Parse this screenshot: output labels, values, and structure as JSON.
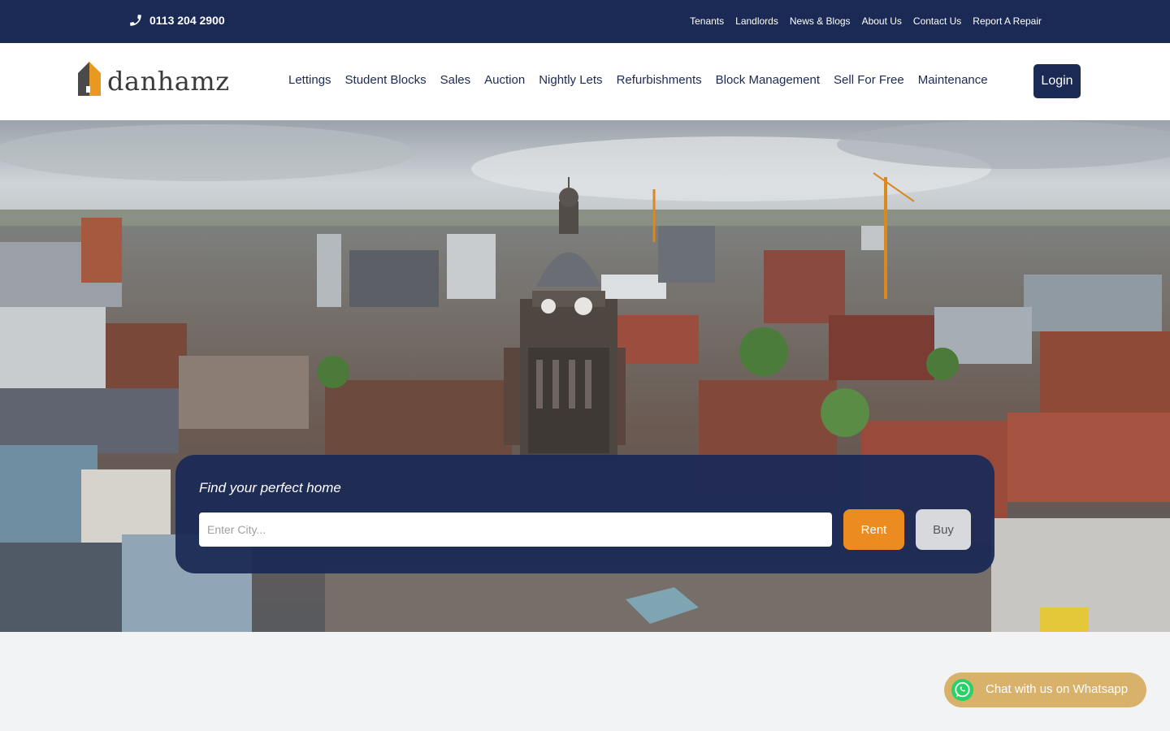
{
  "topbar": {
    "phone": "0113 204 2900",
    "links": [
      "Tenants",
      "Landlords",
      "News & Blogs",
      "About Us",
      "Contact Us",
      "Report A Repair"
    ]
  },
  "header": {
    "logo_text": "danhamz",
    "nav": [
      "Lettings",
      "Student Blocks",
      "Sales",
      "Auction",
      "Nightly Lets",
      "Refurbishments",
      "Block Management",
      "Sell For Free",
      "Maintenance"
    ],
    "login_label": "Login"
  },
  "search": {
    "title": "Find your perfect home",
    "placeholder": "Enter City...",
    "value": "",
    "rent_label": "Rent",
    "buy_label": "Buy"
  },
  "chat": {
    "label": "Chat with us on Whatsapp"
  },
  "colors": {
    "navy": "#1b2a55",
    "orange": "#ec8b1f",
    "gold": "#d8b16b",
    "whatsapp_green": "#25d366"
  },
  "icons": {
    "phone": "phone-icon",
    "logo": "house-logo-icon",
    "whatsapp": "whatsapp-icon"
  }
}
